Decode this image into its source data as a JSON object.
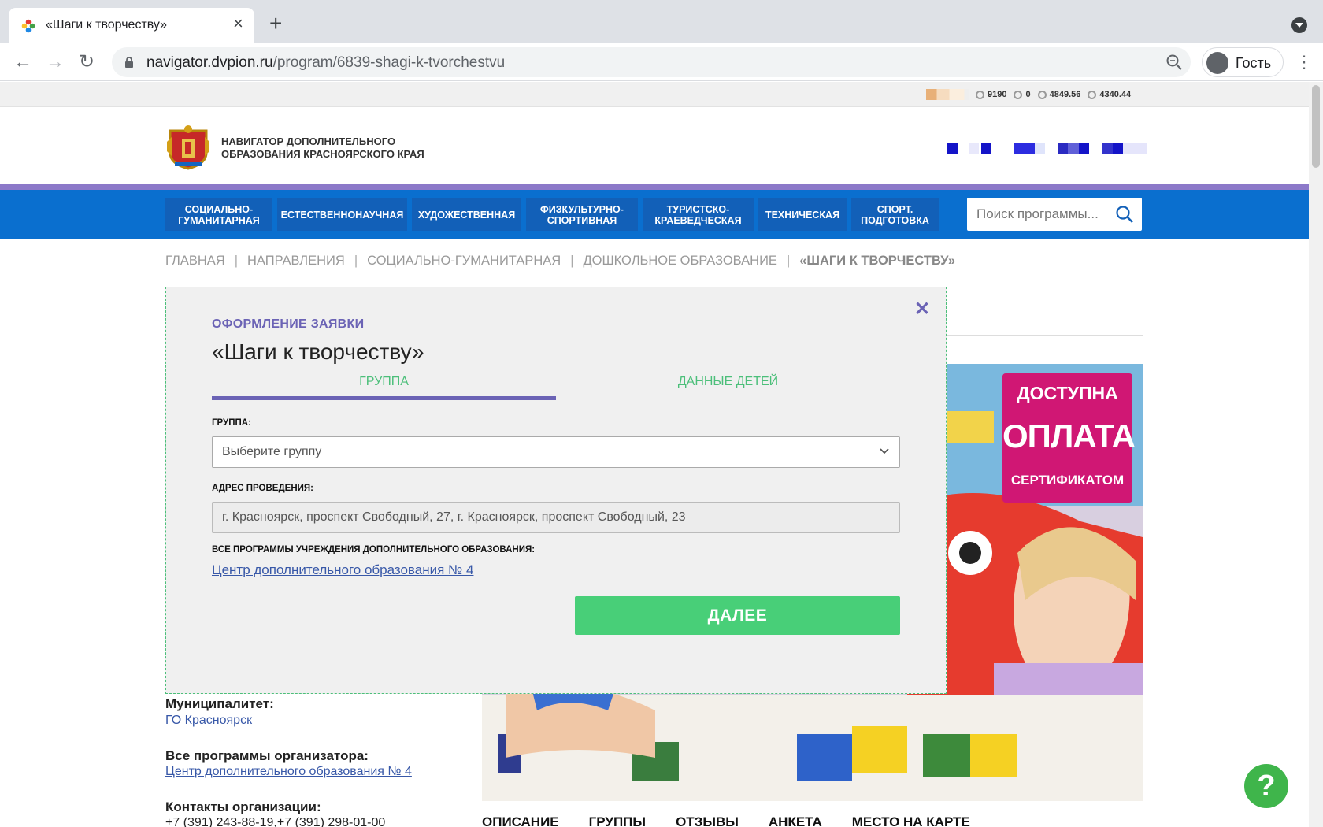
{
  "browser": {
    "tab_title": "«Шаги к творчеству»",
    "url_domain": "navigator.dvpion.ru",
    "url_path": "/program/6839-shagi-k-tvorchestvu",
    "profile_label": "Гость"
  },
  "stats": {
    "value1": "9190",
    "value2": "0",
    "value3": "4849.56",
    "value4": "4340.44"
  },
  "header": {
    "logo_line1": "НАВИГАТОР ДОПОЛНИТЕЛЬНОГО",
    "logo_line2": "ОБРАЗОВАНИЯ КРАСНОЯРСКОГО КРАЯ"
  },
  "nav": {
    "items": [
      {
        "line1": "СОЦИАЛЬНО-",
        "line2": "ГУМАНИТАРНАЯ"
      },
      {
        "line1": "ЕСТЕСТВЕННОНАУЧНАЯ",
        "line2": ""
      },
      {
        "line1": "ХУДОЖЕСТВЕННАЯ",
        "line2": ""
      },
      {
        "line1": "ФИЗКУЛЬТУРНО-",
        "line2": "СПОРТИВНАЯ"
      },
      {
        "line1": "ТУРИСТСКО-",
        "line2": "КРАЕВЕДЧЕСКАЯ"
      },
      {
        "line1": "ТЕХНИЧЕСКАЯ",
        "line2": ""
      },
      {
        "line1": "СПОРТ.",
        "line2": "ПОДГОТОВКА"
      }
    ],
    "search_placeholder": "Поиск программы..."
  },
  "breadcrumb": {
    "items": [
      "ГЛАВНАЯ",
      "НАПРАВЛЕНИЯ",
      "СОЦИАЛЬНО-ГУМАНИТАРНАЯ",
      "ДОШКОЛЬНОЕ ОБРАЗОВАНИЕ"
    ],
    "current": "«ШАГИ К ТВОРЧЕСТВУ»"
  },
  "promo": {
    "line1": "ДОСТУПНА",
    "line2": "ОПЛАТА",
    "line3": "СЕРТИФИКАТОМ"
  },
  "info": {
    "municipality_label": "Муниципалитет:",
    "municipality_value": "ГО Красноярск",
    "organizer_label": "Все программы организатора:",
    "organizer_value": "Центр дополнительного образования № 4",
    "contacts_label": "Контакты организации:",
    "contacts_value": "+7 (391) 243-88-19,+7 (391) 298-01-00"
  },
  "content_tabs": [
    "ОПИСАНИЕ",
    "ГРУППЫ",
    "ОТЗЫВЫ",
    "АНКЕТА",
    "МЕСТО НА КАРТЕ"
  ],
  "modal": {
    "kicker": "ОФОРМЛЕНИЕ ЗАЯВКИ",
    "title": "«Шаги к творчеству»",
    "tab_group": "ГРУППА",
    "tab_children": "ДАННЫЕ ДЕТЕЙ",
    "group_label": "ГРУППА:",
    "group_select": "Выберите группу",
    "address_label": "АДРЕС ПРОВЕДЕНИЯ:",
    "address_value": "г. Красноярск, проспект Свободный, 27, г. Красноярск, проспект Свободный, 23",
    "programs_label": "ВСЕ ПРОГРАММЫ УЧРЕЖДЕНИЯ ДОПОЛНИТЕЛЬНОГО ОБРАЗОВАНИЯ:",
    "programs_link": "Центр дополнительного образования № 4",
    "next_button": "ДАЛЕЕ"
  },
  "colors": {
    "nav_blue": "#0a6fcf",
    "accent_purple": "#6b63b5",
    "accent_green": "#48cf78",
    "promo_pink": "#d01774"
  },
  "icons": [
    "favicon-icon",
    "close-icon",
    "plus-icon",
    "back-icon",
    "forward-icon",
    "reload-icon",
    "lock-icon",
    "zoom-icon",
    "avatar-icon",
    "more-icon",
    "search-icon",
    "chevron-down-icon",
    "help-icon"
  ]
}
